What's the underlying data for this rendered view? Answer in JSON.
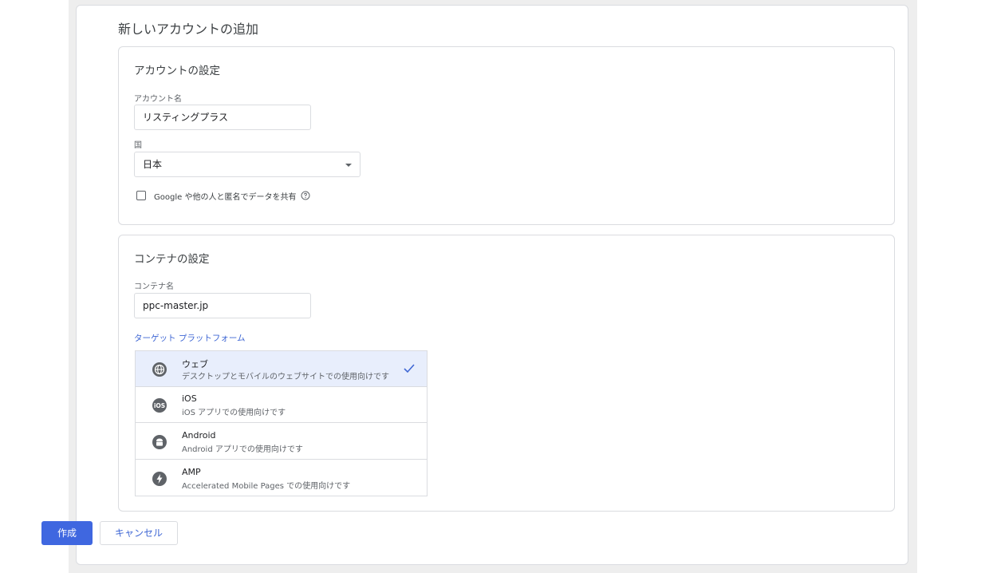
{
  "page_title": "新しいアカウントの追加",
  "account_settings": {
    "title": "アカウントの設定",
    "account_name_label": "アカウント名",
    "account_name_value": "リスティングプラス",
    "country_label": "国",
    "country_value": "日本",
    "share_data_label": "Google や他の人と匿名でデータを共有",
    "share_data_checked": false
  },
  "container_settings": {
    "title": "コンテナの設定",
    "container_name_label": "コンテナ名",
    "container_name_value": "ppc-master.jp",
    "target_platform_label": "ターゲット プラットフォーム",
    "platforms": [
      {
        "name": "ウェブ",
        "description": "デスクトップとモバイルのウェブサイトでの使用向けです",
        "icon": "globe-icon",
        "selected": true
      },
      {
        "name": "iOS",
        "description": "iOS アプリでの使用向けです",
        "icon": "ios-icon",
        "selected": false
      },
      {
        "name": "Android",
        "description": "Android アプリでの使用向けです",
        "icon": "android-icon",
        "selected": false
      },
      {
        "name": "AMP",
        "description": "Accelerated Mobile Pages での使用向けです",
        "icon": "amp-icon",
        "selected": false
      }
    ]
  },
  "buttons": {
    "create": "作成",
    "cancel": "キャンセル"
  },
  "colors": {
    "primary": "#3f67e0",
    "selected_row": "#e8eefc",
    "link": "#3f67d4"
  }
}
